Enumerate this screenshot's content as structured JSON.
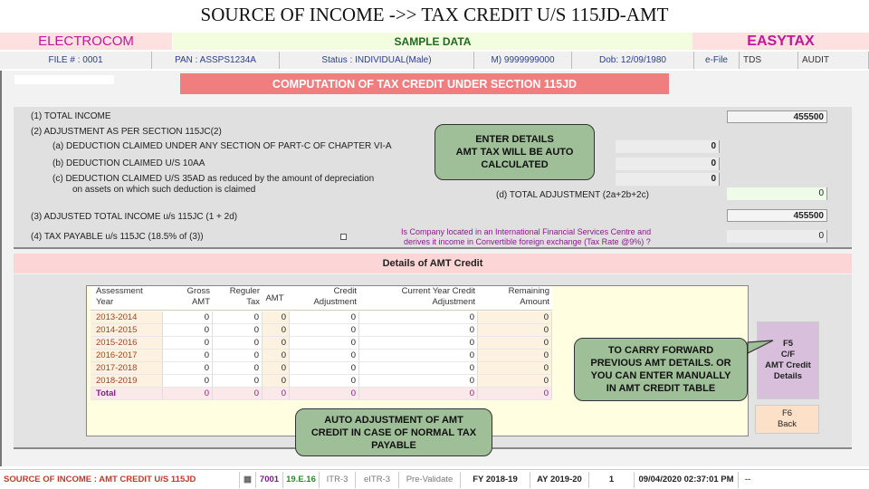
{
  "title": "SOURCE OF INCOME ->> TAX CREDIT U/S 115JD-AMT",
  "header": {
    "left": "ELECTROCOM",
    "center": "SAMPLE DATA",
    "right": "EASYTAX"
  },
  "info": {
    "file": "FILE # : 0001",
    "pan": "PAN : ASSPS1234A",
    "status": "Status : INDIVIDUAL(Male)",
    "mobile": "M) 9999999000",
    "dob": "Dob: 12/09/1980",
    "efile": "e-File",
    "tds": "TDS",
    "audit": "AUDIT"
  },
  "banner": "COMPUTATION OF TAX CREDIT UNDER SECTION 115JD",
  "computation": {
    "total_income_label": "(1)  TOTAL INCOME",
    "total_income": "455500",
    "adjustment_label": "(2)  ADJUSTMENT AS PER SECTION 115JC(2)",
    "a_label": "(a)   DEDUCTION CLAIMED UNDER ANY SECTION OF PART-C OF CHAPTER VI-A",
    "a_value": "0",
    "b_label": "(b)   DEDUCTION CLAIMED U/S 10AA",
    "b_value": "0",
    "c_label": "(c)   DEDUCTION CLAIMED U/S 35AD as reduced by the amount of depreciation",
    "c_label2": "on assets on which such deduction is claimed",
    "c_value": "0",
    "d_label": "(d)   TOTAL ADJUSTMENT (2a+2b+2c)",
    "d_value": "0",
    "adjusted_label": "(3)  ADJUSTED TOTAL INCOME u/s 115JC (1 + 2d)",
    "adjusted_value": "455500",
    "tax_label": "(4)  TAX PAYABLE u/s 115JC (18.5% of (3))",
    "ifsc_question": "Is Company located in an International Financial Services Centre and",
    "ifsc_question2": "derives it income in Convertible foreign exchange (Tax Rate @9%) ?",
    "ifsc_checked": false,
    "tax_value": "0"
  },
  "callouts": {
    "enter": [
      "ENTER DETAILS",
      "AMT TAX WILL BE AUTO",
      "CALCULATED"
    ],
    "carry": [
      "TO CARRY FORWARD",
      "PREVIOUS AMT DETAILS. OR",
      "YOU CAN ENTER MANUALLY",
      "IN AMT CREDIT TABLE"
    ],
    "auto": [
      "AUTO ADJUSTMENT OF AMT",
      "CREDIT IN CASE OF NORMAL TAX",
      "PAYABLE"
    ]
  },
  "details_header": "Details of AMT Credit",
  "table": {
    "headers": [
      [
        "Assessment",
        "Year"
      ],
      [
        "Gross",
        "AMT"
      ],
      [
        "Reguler",
        "Tax"
      ],
      [
        "AMT",
        ""
      ],
      [
        "Credit",
        "Adjustment"
      ],
      [
        "Current Year Credit",
        "Adjustment"
      ],
      [
        "Remaining",
        "Amount"
      ]
    ],
    "rows": [
      [
        "2013-2014",
        "0",
        "0",
        "0",
        "0",
        "0",
        "0"
      ],
      [
        "2014-2015",
        "0",
        "0",
        "0",
        "0",
        "0",
        "0"
      ],
      [
        "2015-2016",
        "0",
        "0",
        "0",
        "0",
        "0",
        "0"
      ],
      [
        "2016-2017",
        "0",
        "0",
        "0",
        "0",
        "0",
        "0"
      ],
      [
        "2017-2018",
        "0",
        "0",
        "0",
        "0",
        "0",
        "0"
      ],
      [
        "2018-2019",
        "0",
        "0",
        "0",
        "0",
        "0",
        "0"
      ],
      [
        "Total",
        "0",
        "0",
        "0",
        "0",
        "0",
        "0"
      ]
    ]
  },
  "buttons": {
    "f5": [
      "F5",
      "C/F",
      "AMT Credit",
      "Details"
    ],
    "f6": [
      "F6",
      "Back"
    ]
  },
  "statusbar": {
    "section": "SOURCE OF INCOME : AMT CREDIT U/S 115JD",
    "code": "7001",
    "version": "19.E.16",
    "itr": "ITR-3",
    "eitr": "eITR-3",
    "prevalidate": "Pre-Validate",
    "fy": "FY 2018-19",
    "ay": "AY 2019-20",
    "count": "1",
    "datetime": "09/04/2020 02:37:01 PM",
    "more": "--"
  },
  "colors": {
    "brand": "#c0189a",
    "banner": "#f07e7e",
    "callout": "#9fbf98",
    "year_text": "#a0452a",
    "total_text": "#8b1a8b"
  }
}
